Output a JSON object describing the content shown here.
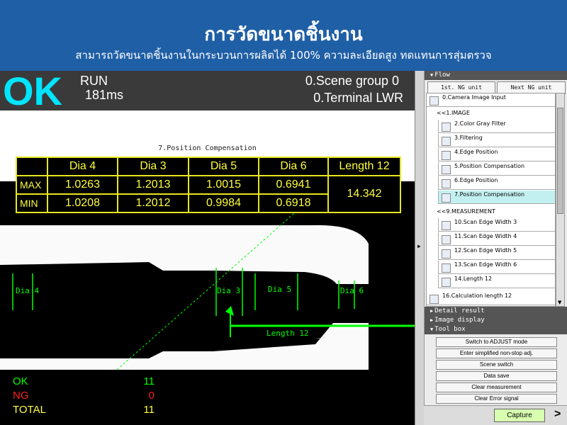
{
  "banner": {
    "title": "การวัดขนาดชิ้นงาน",
    "subtitle": "สามารถวัดขนาดชิ้นงานในกระบวนการผลิตได้ 100% ความละเอียดสูง ทดแทนการสุ่มตรวจ"
  },
  "status": {
    "result": "OK",
    "mode": "RUN",
    "time": "181ms",
    "scene_group": "0.Scene group 0",
    "terminal": "0.Terminal LWR"
  },
  "image": {
    "caption": "7.Position Compensation",
    "labels": {
      "dia4": "Dia 4",
      "dia3": "Dia 3",
      "dia5": "Dia 5",
      "dia6": "Dia 6",
      "length12": "Length 12"
    }
  },
  "measurements": {
    "headers": [
      "Dia 4",
      "Dia 3",
      "Dia 5",
      "Dia 6",
      "Length 12"
    ],
    "max_label": "MAX",
    "min_label": "MIN",
    "max": [
      "1.0263",
      "1.2013",
      "1.0015",
      "0.6941"
    ],
    "min": [
      "1.0208",
      "1.2012",
      "0.9984",
      "0.6918"
    ],
    "length12": "14.342"
  },
  "counts": {
    "ok_label": "OK",
    "ok": "11",
    "ng_label": "NG",
    "ng": "0",
    "total_label": "TOTAL",
    "total": "11"
  },
  "panel": {
    "flow_header": "Flow",
    "prev_ng": "1st. NG unit",
    "next_ng": "Next NG unit",
    "camera_input": "0.Camera Image Input",
    "group_image": "<<1.IMAGE",
    "items_image": [
      "2.Color Gray Filter",
      "3.Filtering",
      "4.Edge Position",
      "5.Position Compensation",
      "6.Edge Position",
      "7.Position Compensation"
    ],
    "group_measurement": "<<9.MEASUREMENT",
    "items_measurement": [
      "10.Scan Edge Width 3",
      "11.Scan Edge Width 4",
      "12.Scan Edge Width 5",
      "13.Scan Edge Width 6",
      "14.Length 12"
    ],
    "calc_item": "16.Calculation length 12",
    "detail_header": "Detail result",
    "image_display_header": "Image display",
    "toolbox_header": "Tool box",
    "tools": [
      "Switch to ADJUST mode",
      "Enter simplified non-stop adj.",
      "Scene switch",
      "Data save",
      "Clear measurement",
      "Clear Error signal"
    ],
    "capture": "Capture",
    "more": ">"
  },
  "colors": {
    "banner": "#1f5fa6",
    "ok": "#00e5ff",
    "overlay": "#00ff00",
    "table": "#ffff3c",
    "ng": "#ff2020",
    "selected": "#c2f0f0"
  },
  "icons": {
    "camera": "camera-icon",
    "filter": "filter-icon",
    "edge": "edge-position-icon",
    "compensation": "position-compensation-icon",
    "scan": "scan-edge-icon",
    "length": "length-icon",
    "calc": "calculation-icon"
  }
}
